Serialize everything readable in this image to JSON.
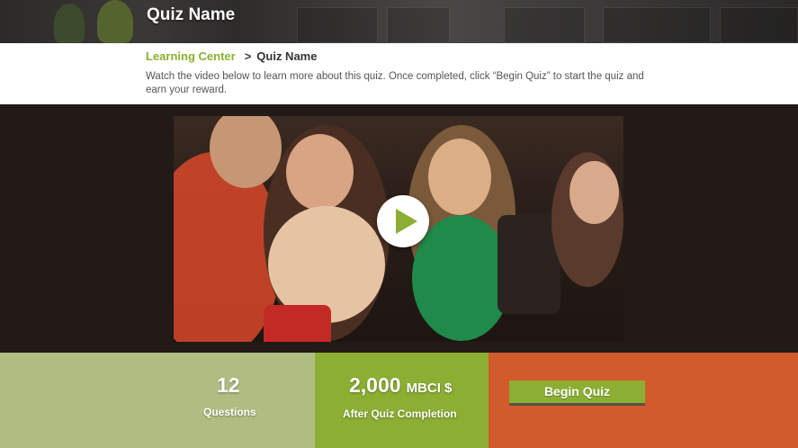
{
  "header": {
    "title": "Quiz Name"
  },
  "breadcrumb": {
    "root": "Learning Center",
    "separator": ">",
    "current": "Quiz Name"
  },
  "intro": {
    "text": "Watch the video below to learn more about this quiz. Once completed, click “Begin Quiz” to start the quiz and earn your reward."
  },
  "video": {
    "play_icon": "play-icon"
  },
  "stats": {
    "questions_count": "12",
    "questions_label": "Questions",
    "reward_amount": "2,000",
    "reward_unit": "MBCI $",
    "reward_label": "After Quiz Completion"
  },
  "cta": {
    "begin_label": "Begin Quiz"
  },
  "colors": {
    "accent_green": "#8cae32",
    "muted_green": "#b0bd82",
    "cta_orange": "#d15b2b",
    "video_band": "#211a17"
  }
}
